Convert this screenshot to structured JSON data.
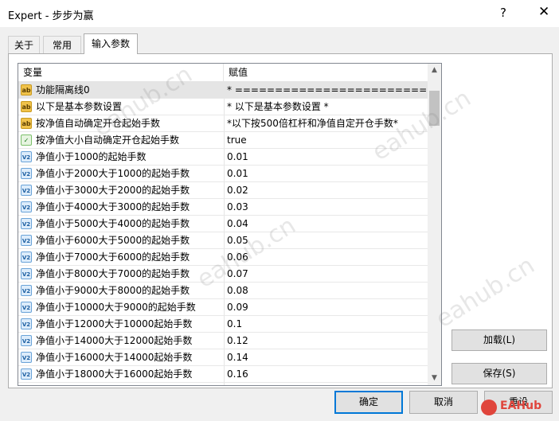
{
  "window": {
    "title": "Expert - 步步为赢",
    "help_glyph": "?",
    "close_glyph": "✕"
  },
  "tabs": [
    {
      "label": "关于",
      "active": false
    },
    {
      "label": "常用",
      "active": false
    },
    {
      "label": "输入参数",
      "active": true
    }
  ],
  "grid": {
    "headers": {
      "variable": "变量",
      "value": "赋值"
    },
    "rows": [
      {
        "type": "ab",
        "icon": "string-type-icon",
        "badge": "ab",
        "name": "功能隔离线0",
        "value": "* ==========================...",
        "selected": true
      },
      {
        "type": "ab",
        "icon": "string-type-icon",
        "badge": "ab",
        "name": "以下是基本参数设置",
        "value": "* 以下是基本参数设置 *"
      },
      {
        "type": "ab",
        "icon": "string-type-icon",
        "badge": "ab",
        "name": "按净值自动确定开仓起始手数",
        "value": "*以下按500倍杠杆和净值自定开仓手数*"
      },
      {
        "type": "bool",
        "icon": "bool-type-icon",
        "badge": "✓",
        "name": "按净值大小自动确定开仓起始手数",
        "value": "true"
      },
      {
        "type": "num",
        "icon": "double-type-icon",
        "badge": "V2",
        "name": "净值小于1000的起始手数",
        "value": "0.01"
      },
      {
        "type": "num",
        "icon": "double-type-icon",
        "badge": "V2",
        "name": "净值小于2000大于1000的起始手数",
        "value": "0.01"
      },
      {
        "type": "num",
        "icon": "double-type-icon",
        "badge": "V2",
        "name": "净值小于3000大于2000的起始手数",
        "value": "0.02"
      },
      {
        "type": "num",
        "icon": "double-type-icon",
        "badge": "V2",
        "name": "净值小于4000大于3000的起始手数",
        "value": "0.03"
      },
      {
        "type": "num",
        "icon": "double-type-icon",
        "badge": "V2",
        "name": "净值小于5000大于4000的起始手数",
        "value": "0.04"
      },
      {
        "type": "num",
        "icon": "double-type-icon",
        "badge": "V2",
        "name": "净值小于6000大于5000的起始手数",
        "value": "0.05"
      },
      {
        "type": "num",
        "icon": "double-type-icon",
        "badge": "V2",
        "name": "净值小于7000大于6000的起始手数",
        "value": "0.06"
      },
      {
        "type": "num",
        "icon": "double-type-icon",
        "badge": "V2",
        "name": "净值小于8000大于7000的起始手数",
        "value": "0.07"
      },
      {
        "type": "num",
        "icon": "double-type-icon",
        "badge": "V2",
        "name": "净值小于9000大于8000的起始手数",
        "value": "0.08"
      },
      {
        "type": "num",
        "icon": "double-type-icon",
        "badge": "V2",
        "name": "净值小于10000大于9000的起始手数",
        "value": "0.09"
      },
      {
        "type": "num",
        "icon": "double-type-icon",
        "badge": "V2",
        "name": "净值小于12000大于10000起始手数",
        "value": "0.1"
      },
      {
        "type": "num",
        "icon": "double-type-icon",
        "badge": "V2",
        "name": "净值小于14000大于12000起始手数",
        "value": "0.12"
      },
      {
        "type": "num",
        "icon": "double-type-icon",
        "badge": "V2",
        "name": "净值小于16000大于14000起始手数",
        "value": "0.14"
      },
      {
        "type": "num",
        "icon": "double-type-icon",
        "badge": "V2",
        "name": "净值小于18000大于16000起始手数",
        "value": "0.16"
      },
      {
        "type": "num",
        "icon": "double-type-icon",
        "badge": "V2",
        "name": "",
        "value": ""
      }
    ]
  },
  "scrollbar": {
    "up_glyph": "▲",
    "down_glyph": "▼"
  },
  "side_buttons": {
    "load": "加载(L)",
    "save": "保存(S)"
  },
  "buttons": {
    "ok": "确定",
    "cancel": "取消",
    "reset": "重设"
  },
  "watermark": "eahub.cn",
  "logo": {
    "text": "EAHub"
  }
}
